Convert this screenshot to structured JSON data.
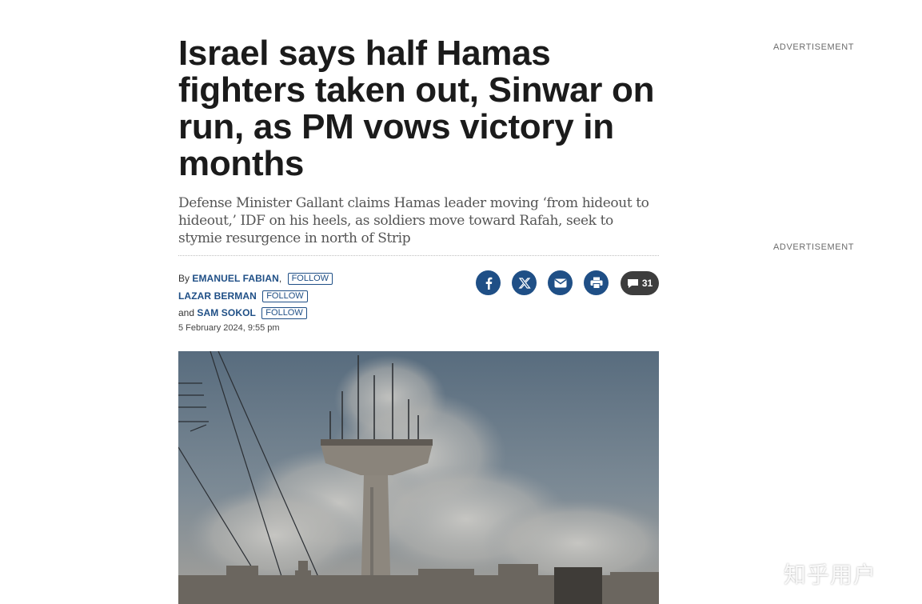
{
  "article": {
    "headline": "Israel says half Hamas fighters taken out, Sinwar on run, as PM vows victory in months",
    "subhead": "Defense Minister Gallant claims Hamas leader moving ‘from hideout to hideout,’ IDF on his heels, as soldiers move toward Rafah, seek to stymie resurgence in north of Strip",
    "byline": {
      "by_label": "By",
      "and_label": "and",
      "comma": ",",
      "follow_label": "FOLLOW",
      "authors": [
        "EMANUEL FABIAN",
        "LAZAR BERMAN",
        "SAM SOKOL"
      ]
    },
    "date": "5 February 2024, 9:55 pm"
  },
  "share": {
    "icons": [
      "facebook-icon",
      "x-twitter-icon",
      "email-icon",
      "print-icon"
    ],
    "comment_count": "31",
    "brand_color": "#1f4f86"
  },
  "sidebar": {
    "ad_label_1": "ADVERTISEMENT",
    "ad_label_2": "ADVERTISEMENT"
  },
  "watermark": "知乎用户"
}
